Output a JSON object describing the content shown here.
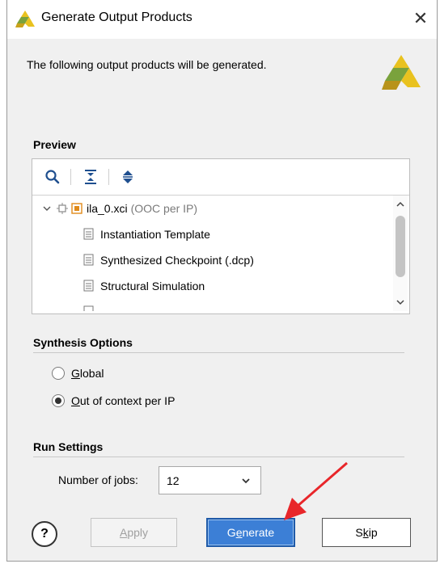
{
  "window": {
    "title": "Generate Output Products",
    "close_glyph": "✕",
    "app_icon": "xilinx-logo-icon"
  },
  "description": "The following output products will be generated.",
  "preview": {
    "section_title": "Preview",
    "toolbar": {
      "search_icon": "search-icon",
      "collapse_icon": "collapse-all-icon",
      "expand_icon": "expand-all-icon"
    },
    "tree": {
      "root": {
        "name": "ila_0.xci",
        "note": "(OOC per IP)"
      },
      "children": [
        "Instantiation Template",
        "Synthesized Checkpoint (.dcp)",
        "Structural Simulation"
      ]
    }
  },
  "synthesis_options": {
    "section_title": "Synthesis Options",
    "options": [
      {
        "label_mnemonic": "G",
        "label_rest": "lobal",
        "selected": false
      },
      {
        "label_mnemonic": "O",
        "label_rest": "ut of context per IP",
        "selected": true
      }
    ]
  },
  "run_settings": {
    "section_title": "Run Settings",
    "jobs_label_pre": "Number of ",
    "jobs_label_mnemonic": "j",
    "jobs_label_post": "obs:",
    "jobs_value": "12"
  },
  "buttons": {
    "help": "?",
    "apply_mnemonic": "A",
    "apply_rest": "pply",
    "generate_pre": "G",
    "generate_mnemonic": "e",
    "generate_post": "nerate",
    "skip_pre": "S",
    "skip_mnemonic": "k",
    "skip_post": "ip"
  },
  "colors": {
    "primary_button": "#3c7fd6",
    "annotation_arrow": "#e8262a",
    "logo_yellow": "#e9c21f",
    "logo_green": "#7aa23c"
  }
}
